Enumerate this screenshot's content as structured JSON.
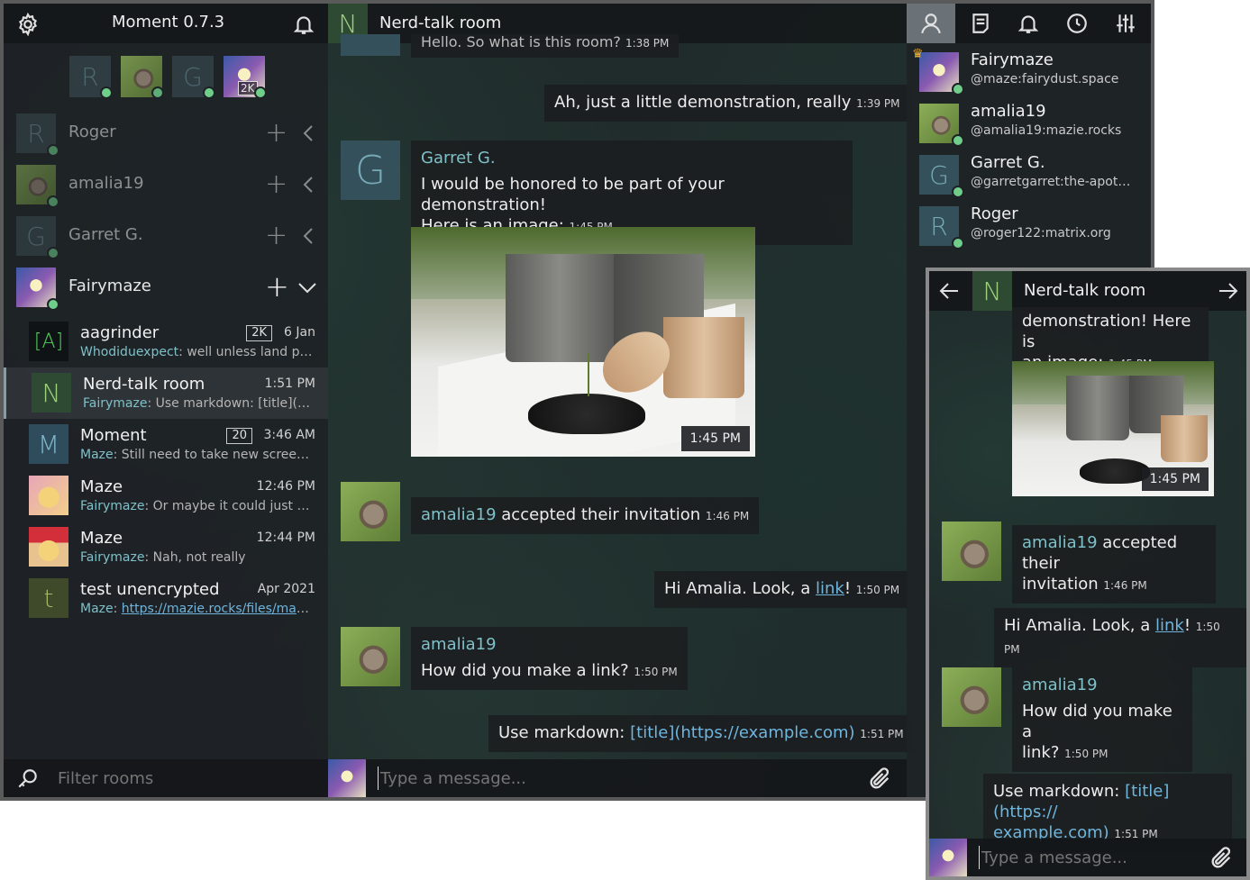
{
  "app": {
    "title": "Moment 0.7.3",
    "filter_placeholder": "Filter rooms"
  },
  "accounts_strip": [
    {
      "letter": "R",
      "badge": ""
    },
    {
      "letter": "",
      "badge": ""
    },
    {
      "letter": "G",
      "badge": ""
    },
    {
      "letter": "",
      "badge": "2K"
    }
  ],
  "accounts": [
    {
      "letter": "R",
      "name": "Roger"
    },
    {
      "letter": "",
      "name": "amalia19"
    },
    {
      "letter": "G",
      "name": "Garret G."
    },
    {
      "letter": "",
      "name": "Fairymaze"
    }
  ],
  "rooms": [
    {
      "letter": "[A]",
      "name": "aagrinder",
      "badge": "2K",
      "time": "6 Jan",
      "sender": "Whodiduexpect",
      "last": ": well unless land pr…"
    },
    {
      "letter": "N",
      "name": "Nerd-talk room",
      "badge": "",
      "time": "1:51 PM",
      "sender": "Fairymaze",
      "last": ": Use markdown: [title](ht…"
    },
    {
      "letter": "M",
      "name": "Moment",
      "badge": "20",
      "time": "3:46 AM",
      "sender": "Maze",
      "last": ": Still need to take new screens…"
    },
    {
      "letter": "",
      "name": "Maze",
      "badge": "",
      "time": "12:46 PM",
      "sender": "Fairymaze",
      "last": ": Or maybe it could just be…"
    },
    {
      "letter": "",
      "name": "Maze",
      "badge": "",
      "time": "12:44 PM",
      "sender": "Fairymaze",
      "last": ": Nah, not really"
    },
    {
      "letter": "t",
      "name": "test unencrypted",
      "badge": "",
      "time": "Apr 2021",
      "sender": "Maze",
      "last": "https://mazie.rocks/files/maz…"
    }
  ],
  "chat": {
    "room_letter": "N",
    "room_name": "Nerd-talk room",
    "composer_placeholder": "Type a message...",
    "top_cut_text": "Hello. So what is this room?",
    "top_cut_time": "1:38 PM",
    "msg1_text": "Ah, just a little demonstration, really",
    "msg1_time": "1:39 PM",
    "msg2_sender": "Garret G.",
    "msg2_line1": "I would be honored to be part of your demonstration!",
    "msg2_line2": "Here is an image:",
    "msg2_time": "1:45 PM",
    "image_time": "1:45 PM",
    "event_sender": "amalia19",
    "event_text": "accepted their invitation",
    "event_time": "1:46 PM",
    "msg3_text": "Hi Amalia. Look, a",
    "msg3_link": "link",
    "msg3_suffix": "!",
    "msg3_time": "1:50 PM",
    "msg4_sender": "amalia19",
    "msg4_text": "How did you make a link?",
    "msg4_time": "1:50 PM",
    "msg5_text": "Use markdown:",
    "msg5_link": "[title](https://example.com)",
    "msg5_time": "1:51 PM"
  },
  "members": [
    {
      "letter": "",
      "name": "Fairymaze",
      "id": "@maze:fairydust.space"
    },
    {
      "letter": "",
      "name": "amalia19",
      "id": "@amalia19:mazie.rocks"
    },
    {
      "letter": "G",
      "name": "Garret G.",
      "id": "@garretgarret:the-apot…"
    },
    {
      "letter": "R",
      "name": "Roger",
      "id": "@roger122:matrix.org"
    }
  ],
  "mobile": {
    "room_letter": "N",
    "room_name": "Nerd-talk room",
    "top_line1": "demonstration! Here is",
    "top_line2": "an image:",
    "top_time": "1:45 PM",
    "image_time": "1:45 PM",
    "event_sender": "amalia19",
    "event_text1": "accepted their",
    "event_text2": "invitation",
    "event_time": "1:46 PM",
    "msg3_text": "Hi Amalia. Look, a",
    "msg3_link": "link",
    "msg3_suffix": "!",
    "msg3_time": "1:50 PM",
    "msg4_sender": "amalia19",
    "msg4_line1": "How did you make a",
    "msg4_line2": "link?",
    "msg4_time": "1:50 PM",
    "msg5_text": "Use markdown:",
    "msg5_link1": "[title](https://",
    "msg5_link2": "example.com)",
    "msg5_time": "1:51 PM",
    "composer_placeholder": "Type a message..."
  },
  "colors": {
    "accent": "#7ec1c9",
    "link": "#6fb5dd",
    "online": "#6fcf8a",
    "header_active": "#6a7278"
  }
}
